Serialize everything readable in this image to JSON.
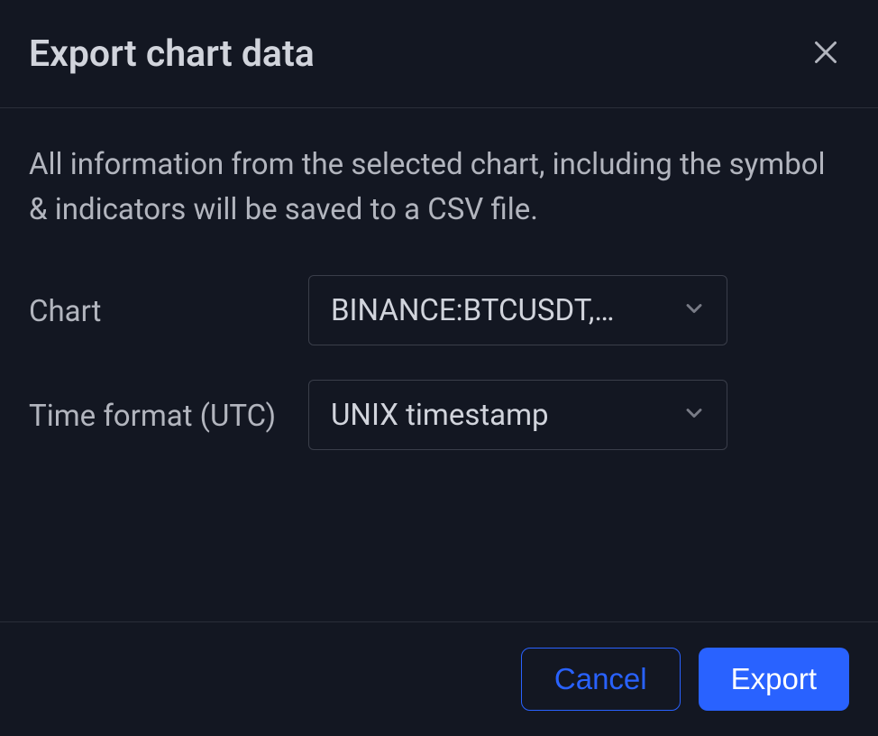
{
  "dialog": {
    "title": "Export chart data",
    "description": "All information from the selected chart, including the symbol & indicators will be saved to a CSV file."
  },
  "form": {
    "chart": {
      "label": "Chart",
      "value": "BINANCE:BTCUSDT,…"
    },
    "timeFormat": {
      "label": "Time format (UTC)",
      "value": "UNIX timestamp"
    }
  },
  "footer": {
    "cancel": "Cancel",
    "export": "Export"
  }
}
